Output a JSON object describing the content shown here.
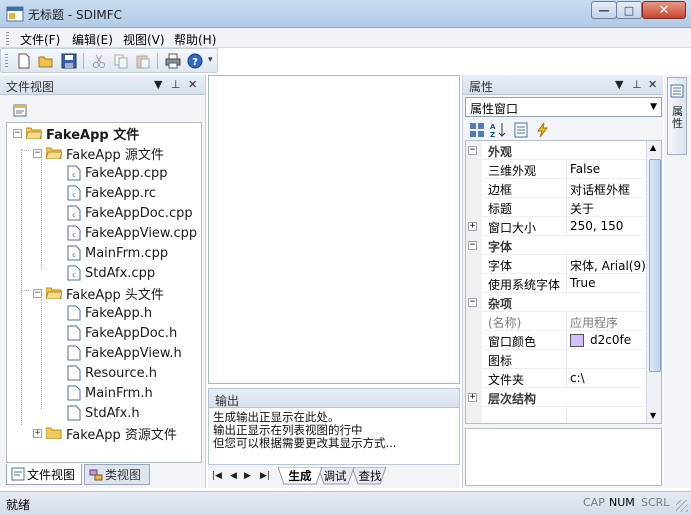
{
  "window": {
    "title": "无标题 - SDIMFC",
    "min_glyph": "—",
    "max_glyph": "□",
    "close_glyph": "✕"
  },
  "menu": [
    "文件(F)",
    "编辑(E)",
    "视图(V)",
    "帮助(H)"
  ],
  "toolbar": [
    "new-icon",
    "open-icon",
    "save-icon",
    "cut-icon",
    "copy-icon",
    "paste-icon",
    "print-icon",
    "help-icon"
  ],
  "fileview": {
    "title": "文件视图",
    "pin_glyph": "▼ ⊥ ✕",
    "tree": {
      "root": "FakeApp 文件",
      "src_folder": "FakeApp 源文件",
      "src_files": [
        "FakeApp.cpp",
        "FakeApp.rc",
        "FakeAppDoc.cpp",
        "FakeAppView.cpp",
        "MainFrm.cpp",
        "StdAfx.cpp"
      ],
      "hdr_folder": "FakeApp 头文件",
      "hdr_files": [
        "FakeApp.h",
        "FakeAppDoc.h",
        "FakeAppView.h",
        "Resource.h",
        "MainFrm.h",
        "StdAfx.h"
      ],
      "res_folder": "FakeApp 资源文件"
    },
    "tabs": [
      "文件视图",
      "类视图"
    ]
  },
  "output": {
    "title": "输出",
    "lines": [
      "生成输出正显示在此处。",
      "输出正显示在列表视图的行中",
      "但您可以根据需要更改其显示方式..."
    ],
    "tabs": [
      "生成",
      "调试",
      "查找"
    ]
  },
  "properties": {
    "title": "属性",
    "combo": "属性窗口",
    "categories": {
      "appearance": "外观",
      "font": "字体",
      "misc": "杂项",
      "hierarchy": "层次结构"
    },
    "rows": {
      "3d_name": "三维外观",
      "3d_value": "False",
      "border_name": "边框",
      "border_value": "对话框外框",
      "caption_name": "标题",
      "caption_value": "关于",
      "winsize_name": "窗口大小",
      "winsize_value": "250, 150",
      "font_name": "字体",
      "font_value": "宋体, Arial(9)",
      "sysfont_name": "使用系统字体",
      "sysfont_value": "True",
      "name_name": "(名称)",
      "name_value": "应用程序",
      "wincolor_name": "窗口颜色",
      "wincolor_value": "d2c0fe",
      "icon_name": "图标",
      "icon_value": "",
      "folder_name": "文件夹",
      "folder_value": "c:\\"
    },
    "swatch_color": "#d2c0fe"
  },
  "side_strip": "属性",
  "status": {
    "text": "就绪",
    "indicators": [
      "CAP",
      "NUM",
      "SCRL"
    ]
  }
}
